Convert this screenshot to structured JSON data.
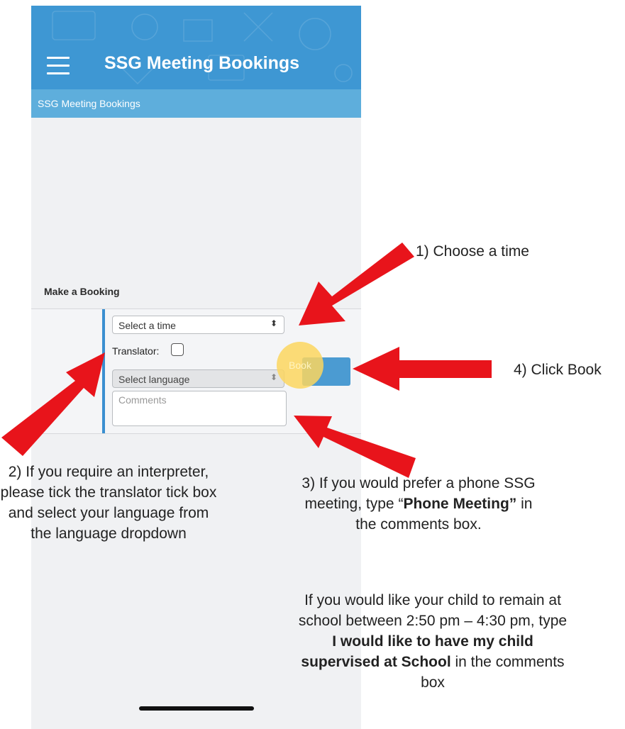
{
  "app": {
    "title": "SSG Meeting Bookings",
    "subtitle": "SSG Meeting Bookings",
    "menu_icon": "hamburger-menu-icon"
  },
  "booking": {
    "heading": "Make a Booking",
    "time_select": {
      "value": "Select a time"
    },
    "translator_label": "Translator:",
    "translator_checked": false,
    "language_select": {
      "value": "Select language",
      "disabled": true
    },
    "comments_placeholder": "Comments",
    "book_label": "Book"
  },
  "annotations": {
    "step1": "1) Choose a time",
    "step2": "2) If you require an interpreter, please tick the translator tick box and select your language from the language dropdown",
    "step3_pre": "3) If you would prefer a phone SSG meeting, type “",
    "step3_bold": "Phone Meeting”",
    "step3_post": " in the comments box.",
    "step3_extra_pre": "If you would like your child to remain at school between 2:50 pm – 4:30 pm, type ",
    "step3_extra_bold": "I would like to have my child supervised at School",
    "step3_extra_post": " in the comments box",
    "step4": "4) Click Book"
  },
  "colors": {
    "app_bar": "#3e97d3",
    "sub_bar": "#5eaedc",
    "accent": "#3a8fd0",
    "arrow": "#e8141b",
    "highlight": "#fcd65f"
  }
}
